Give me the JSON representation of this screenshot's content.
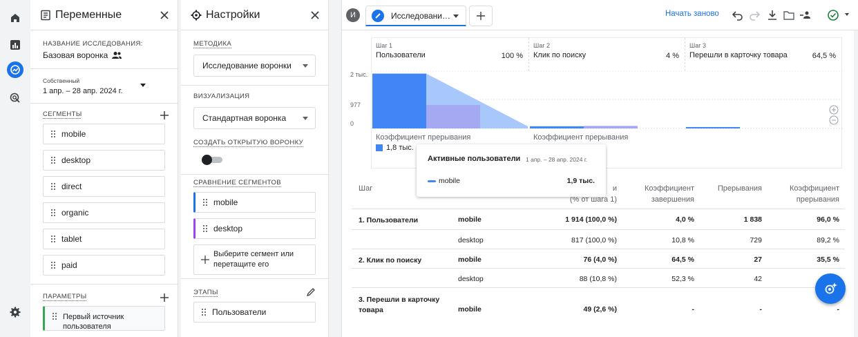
{
  "variables": {
    "title": "Переменные",
    "exploration_label": "НАЗВАНИЕ ИССЛЕДОВАНИЯ:",
    "exploration_name": "Базовая воронка",
    "date_caption": "Собственный",
    "date_range": "1 апр. – 28 апр. 2024 г.",
    "segments_label": "СЕГМЕНТЫ",
    "segments": [
      "mobile",
      "desktop",
      "direct",
      "organic",
      "tablet",
      "paid"
    ],
    "params_label": "ПАРАМЕТРЫ",
    "first_param": "Первый источник пользователя"
  },
  "settings": {
    "title": "Настройки",
    "technique_label": "МЕТОДИКА",
    "technique_value": "Исследование воронки",
    "viz_label": "ВИЗУАЛИЗАЦИЯ",
    "viz_value": "Стандартная воронка",
    "open_funnel_label": "СОЗДАТЬ ОТКРЫТУЮ ВОРОНКУ",
    "compare_label": "СРАВНЕНИЕ СЕГМЕНТОВ",
    "compare_segments": [
      "mobile",
      "desktop"
    ],
    "drop_hint": "Выберите сегмент или перетащите его",
    "steps_label": "ЭТАПЫ",
    "first_step": "Пользователи"
  },
  "main": {
    "avatar_letter": "И",
    "tab_label": "Исследовани…",
    "restart": "Начать заново"
  },
  "chart_data": {
    "type": "bar",
    "categories": [
      "Пользователи",
      "Клик по поиску",
      "Перешли в карточку товара"
    ],
    "step_numbers": [
      "Шаг 1",
      "Шаг 2",
      "Шаг 3"
    ],
    "step_percents": [
      "100 %",
      "4 %",
      "64,5 %"
    ],
    "y_ticks": [
      "2 тыс.",
      "977",
      "0"
    ],
    "ylim": [
      0,
      2000
    ],
    "series": [
      {
        "name": "mobile",
        "values": [
          1914,
          76,
          49
        ],
        "color": "#4285f4"
      },
      {
        "name": "desktop",
        "values": [
          817,
          88,
          0
        ],
        "color": "#a5a9f2"
      }
    ],
    "drop_label": "Коэффициент прерывания",
    "drop_value": "1,8 тыс."
  },
  "tooltip": {
    "title": "Активные пользователи",
    "date": "1 апр. – 28 апр. 2024 г.",
    "series": "mobile",
    "value": "1,9 тыс."
  },
  "table": {
    "headers": {
      "step": "Шаг",
      "users_tail": "и",
      "users_sub": "(% от шага 1)",
      "completion": "Коэффициент завершения",
      "dropoffs": "Прерывания",
      "dropoff_rate": "Коэффициент прерывания"
    },
    "rows": [
      {
        "step": "1. Пользователи",
        "segment": "mobile",
        "users": "1 914 (100,0 %)",
        "completion": "4,0 %",
        "dropoffs": "1 838",
        "rate": "96,0 %",
        "bold": true
      },
      {
        "step": "",
        "segment": "desktop",
        "users": "817 (100,0 %)",
        "completion": "10,8 %",
        "dropoffs": "729",
        "rate": "89,2 %",
        "bold": false
      },
      {
        "step": "2. Клик по поиску",
        "segment": "mobile",
        "users": "76 (4,0 %)",
        "completion": "64,5 %",
        "dropoffs": "27",
        "rate": "35,5 %",
        "bold": true
      },
      {
        "step": "",
        "segment": "desktop",
        "users": "88 (10,8 %)",
        "completion": "52,3 %",
        "dropoffs": "42",
        "rate": "",
        "bold": false
      },
      {
        "step": "3. Перешли в карточку товара",
        "segment": "mobile",
        "users": "49 (2,6 %)",
        "completion": "-",
        "dropoffs": "-",
        "rate": "-",
        "bold": true
      }
    ]
  }
}
